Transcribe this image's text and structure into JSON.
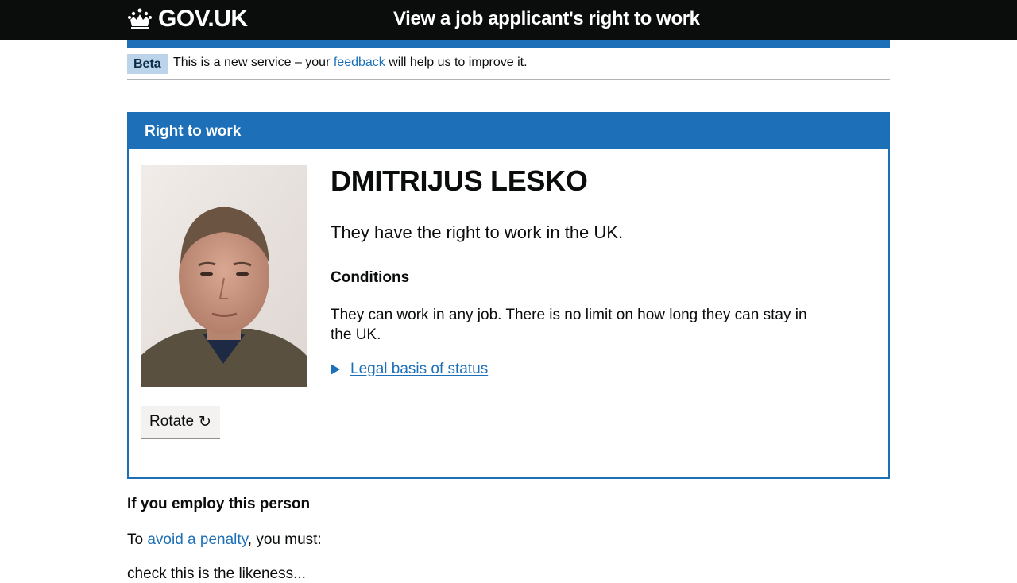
{
  "header": {
    "logo_text": "GOV.UK",
    "service_name": "View a job applicant's right to work"
  },
  "phase_banner": {
    "tag": "Beta",
    "text_before": "This is a new service – your ",
    "link_text": "feedback",
    "text_after": " will help us to improve it."
  },
  "panel": {
    "title": "Right to work",
    "photo_alt": "Photo of applicant",
    "rotate_label": "Rotate",
    "rotate_icon": "↻",
    "name": "DMITRIJUS LESKO",
    "status": "They have the right to work in the UK.",
    "conditions_heading": "Conditions",
    "conditions_text": "They can work in any job. There is no limit on how long they can stay in the UK.",
    "details_label": "Legal basis of status"
  },
  "employer": {
    "heading": "If you employ this person",
    "penalty_before": "To ",
    "penalty_link": "avoid a penalty",
    "penalty_after": ", you must:",
    "first_bullet": "check this is the likeness..."
  },
  "colors": {
    "header_bg": "#0b0c0c",
    "brand_blue": "#1d70b8",
    "phase_tag_bg": "#bbd4ea",
    "button_bg": "#f3f2f1"
  }
}
